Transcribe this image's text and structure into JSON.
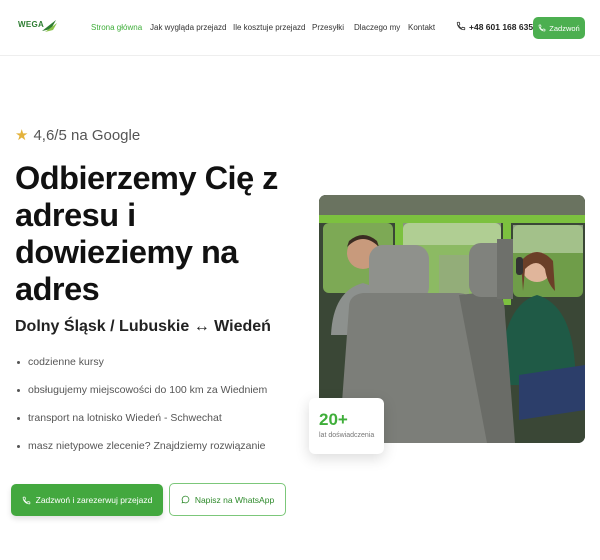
{
  "header": {
    "logo_text": "WEGA",
    "nav": [
      {
        "label": "Strona główna",
        "active": true
      },
      {
        "label": "Jak wygląda przejazd",
        "active": false
      },
      {
        "label": "Ile kosztuje przejazd",
        "active": false
      },
      {
        "label": "Przesyłki",
        "active": false
      },
      {
        "label": "Dlaczego my",
        "active": false
      },
      {
        "label": "Kontakt",
        "active": false
      }
    ],
    "phone": "+48 601 168 635",
    "call_button": "Zadzwoń"
  },
  "hero": {
    "rating": "4,6/5 na Google",
    "title": "Odbierzemy Cię z adresu i dowieziemy na adres",
    "route": "Dolny Śląsk / Lubuskie ↔ Wiedeń",
    "bullets": [
      "codzienne kursy",
      "obsługujemy miejscowości do 100 km za Wiedniem",
      "transport na lotnisko Wiedeń - Schwechat",
      "masz nietypowe zlecenie? Znajdziemy rozwiązanie"
    ],
    "cta_primary": "Zadzwoń i zarezerwuj przejazd",
    "cta_secondary": "Napisz na WhatsApp",
    "experience": {
      "number": "20+",
      "label": "lat doświadczenia"
    }
  },
  "colors": {
    "accent": "#4caf50",
    "accent_dark": "#3fae3a",
    "star": "#e3b23c"
  },
  "icons": [
    "phone-icon",
    "star-icon",
    "whatsapp-icon"
  ]
}
